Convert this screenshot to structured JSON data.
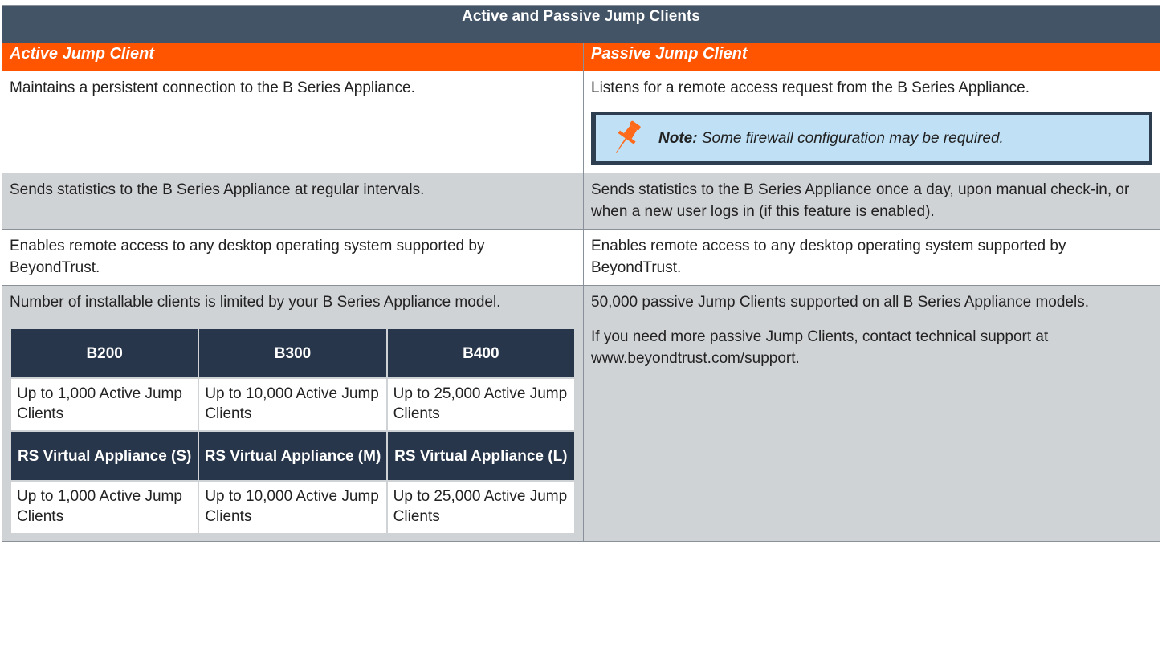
{
  "table": {
    "title": "Active and Passive Jump Clients",
    "col_headers": [
      "Active Jump Client",
      "Passive Jump Client"
    ],
    "rows": [
      {
        "active": "Maintains a persistent connection to the B Series Appliance.",
        "passive": "Listens for a remote access request from the B Series Appliance.",
        "note": {
          "icon": "pushpin-icon",
          "label": "Note:",
          "text": " Some firewall configuration may be required."
        }
      },
      {
        "active": "Sends statistics to the B Series Appliance at regular intervals.",
        "passive": "Sends statistics to the B Series Appliance once a day, upon manual check-in, or when a new user logs in (if this feature is enabled)."
      },
      {
        "active": "Enables remote access to any desktop operating system supported by BeyondTrust.",
        "passive": "Enables remote access to any desktop operating system supported by BeyondTrust."
      },
      {
        "active": "Number of installable clients is limited by your B Series Appliance model.",
        "passive_p1": "50,000 passive Jump Clients supported on all B Series Appliance models.",
        "passive_p2": "If you need more passive Jump Clients, contact technical support at www.beyondtrust.com/support."
      }
    ],
    "models": {
      "header1": [
        "B200",
        "B300",
        "B400"
      ],
      "row1": [
        "Up to 1,000 Active Jump Clients",
        "Up to 10,000 Active Jump Clients",
        "Up to 25,000 Active Jump Clients"
      ],
      "header2": [
        "RS Virtual Appliance (S)",
        "RS Virtual Appliance (M)",
        "RS Virtual Appliance (L)"
      ],
      "row2": [
        "Up to 1,000 Active Jump Clients",
        "Up to 10,000 Active Jump Clients",
        "Up to 25,000 Active Jump Clients"
      ]
    }
  },
  "colors": {
    "title_bg": "#425466",
    "subhead_bg": "#ff5500",
    "grey_row": "#d0d3d6",
    "note_bg": "#bfe0f5",
    "inner_head_bg": "#27364a",
    "pin": "#ff6a1a"
  }
}
